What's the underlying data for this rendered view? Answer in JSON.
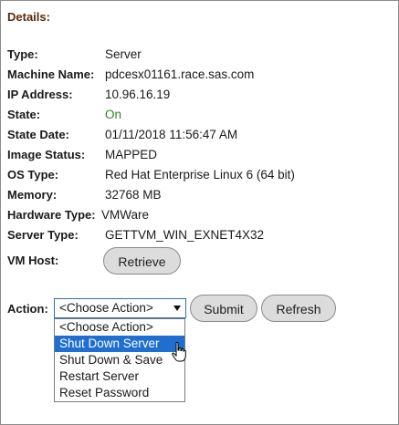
{
  "section_title": "Details:",
  "fields": [
    {
      "label": "Type:",
      "value": "Server"
    },
    {
      "label": "Machine Name:",
      "value": "pdcesx01161.race.sas.com"
    },
    {
      "label": "IP Address:",
      "value": "10.96.16.19"
    },
    {
      "label": "State:",
      "value": "On"
    },
    {
      "label": "State Date:",
      "value": "01/11/2018 11:56:47 AM"
    },
    {
      "label": "Image Status:",
      "value": "MAPPED"
    },
    {
      "label": "OS Type:",
      "value": "Red Hat Enterprise Linux 6 (64 bit)"
    },
    {
      "label": "Memory:",
      "value": "32768 MB"
    },
    {
      "label": "Hardware Type:",
      "value": "VMWare"
    },
    {
      "label": "Server Type:",
      "value": "GETTVM_WIN_EXNET4X32"
    }
  ],
  "vm_host": {
    "label": "VM Host:",
    "button": "Retrieve"
  },
  "action": {
    "label": "Action:",
    "selected": "<Choose Action>",
    "options": [
      "<Choose Action>",
      "Shut Down Server",
      "Shut Down & Save",
      "Restart Server",
      "Reset Password"
    ],
    "highlighted_option": "Shut Down Server",
    "submit": "Submit",
    "refresh": "Refresh"
  },
  "colors": {
    "title": "#5a2a0c",
    "state_on": "#3a7a2a",
    "highlight": "#1e6fd0",
    "button_bg": "#dcdcdc"
  }
}
